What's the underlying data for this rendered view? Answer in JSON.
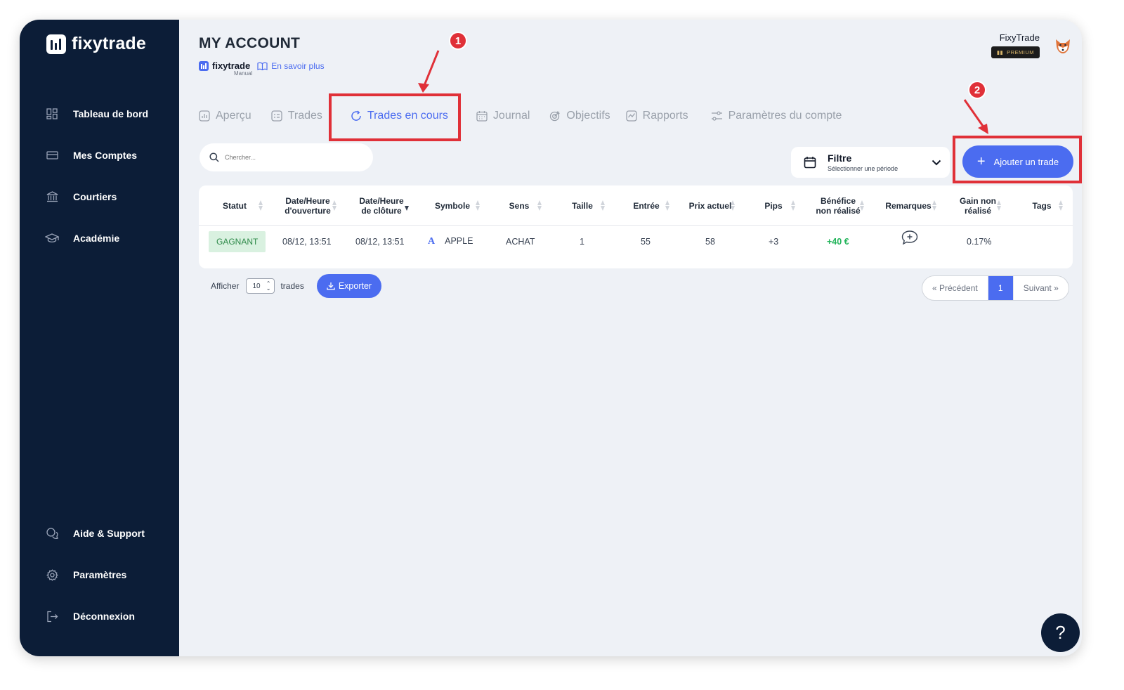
{
  "brand": {
    "name": "fixytrade",
    "icon": "fixytrade-logo-icon"
  },
  "sidebar": {
    "items": [
      {
        "label": "Tableau de bord",
        "icon": "dashboard-grid-icon"
      },
      {
        "label": "Mes Comptes",
        "icon": "card-icon"
      },
      {
        "label": "Courtiers",
        "icon": "bank-icon"
      },
      {
        "label": "Académie",
        "icon": "graduation-cap-icon"
      }
    ],
    "bottom_items": [
      {
        "label": "Aide & Support",
        "icon": "support-icon"
      },
      {
        "label": "Paramètres",
        "icon": "gear-icon"
      },
      {
        "label": "Déconnexion",
        "icon": "logout-icon"
      }
    ]
  },
  "header": {
    "title": "MY ACCOUNT",
    "sub_brand": "fixytrade",
    "sub_tag": "Manual",
    "learn_more": "En savoir plus",
    "user_name": "FixyTrade",
    "premium_badge": "PREMIUM"
  },
  "tabs": [
    {
      "label": "Aperçu",
      "icon": "chart-icon",
      "active": false
    },
    {
      "label": "Trades",
      "icon": "list-icon",
      "active": false
    },
    {
      "label": "Trades en cours",
      "icon": "refresh-icon",
      "active": true
    },
    {
      "label": "Journal",
      "icon": "calendar-icon",
      "active": false
    },
    {
      "label": "Objectifs",
      "icon": "target-icon",
      "active": false
    },
    {
      "label": "Rapports",
      "icon": "report-icon",
      "active": false
    },
    {
      "label": "Paramètres du compte",
      "icon": "sliders-icon",
      "active": false
    }
  ],
  "annotations": {
    "marker1": "1",
    "marker2": "2"
  },
  "toolbar": {
    "search_placeholder": "Chercher...",
    "filter_title": "Filtre",
    "filter_sub": "Sélectionner une période",
    "add_trade": "Ajouter un trade"
  },
  "table": {
    "columns": [
      "Statut",
      "Date/Heure d'ouverture",
      "Date/Heure de clôture",
      "Symbole",
      "Sens",
      "Taille",
      "Entrée",
      "Prix actuel",
      "Pips",
      "Bénéfice non réalisé",
      "Remarques",
      "Gain non réalisé",
      "Tags"
    ],
    "col_html": [
      "Statut",
      "Date/Heure<br>d'ouverture",
      "Date/Heure<br>de clôture",
      "Symbole",
      "Sens",
      "Taille",
      "Entrée",
      "Prix actuel",
      "Pips",
      "Bénéfice<br>non réalisé",
      "Remarques",
      "Gain non<br>réalisé",
      "Tags"
    ],
    "rows": [
      {
        "status": "GAGNANT",
        "open": "08/12, 13:51",
        "close": "08/12, 13:51",
        "symbol_icon": "A",
        "symbol": "APPLE",
        "side": "ACHAT",
        "size": "1",
        "entry": "55",
        "price": "58",
        "pips": "+3",
        "profit": "+40 €",
        "gain": "0.17%",
        "tags": ""
      }
    ]
  },
  "footer": {
    "show_label": "Afficher",
    "page_size": "10",
    "trades_label": "trades",
    "export": "Exporter",
    "prev": "« Précédent",
    "page": "1",
    "next": "Suivant »"
  },
  "help": "?",
  "colors": {
    "sidebar": "#0c1d37",
    "accent": "#4b6cf0",
    "highlight": "#e03038",
    "success": "#22b45a"
  }
}
